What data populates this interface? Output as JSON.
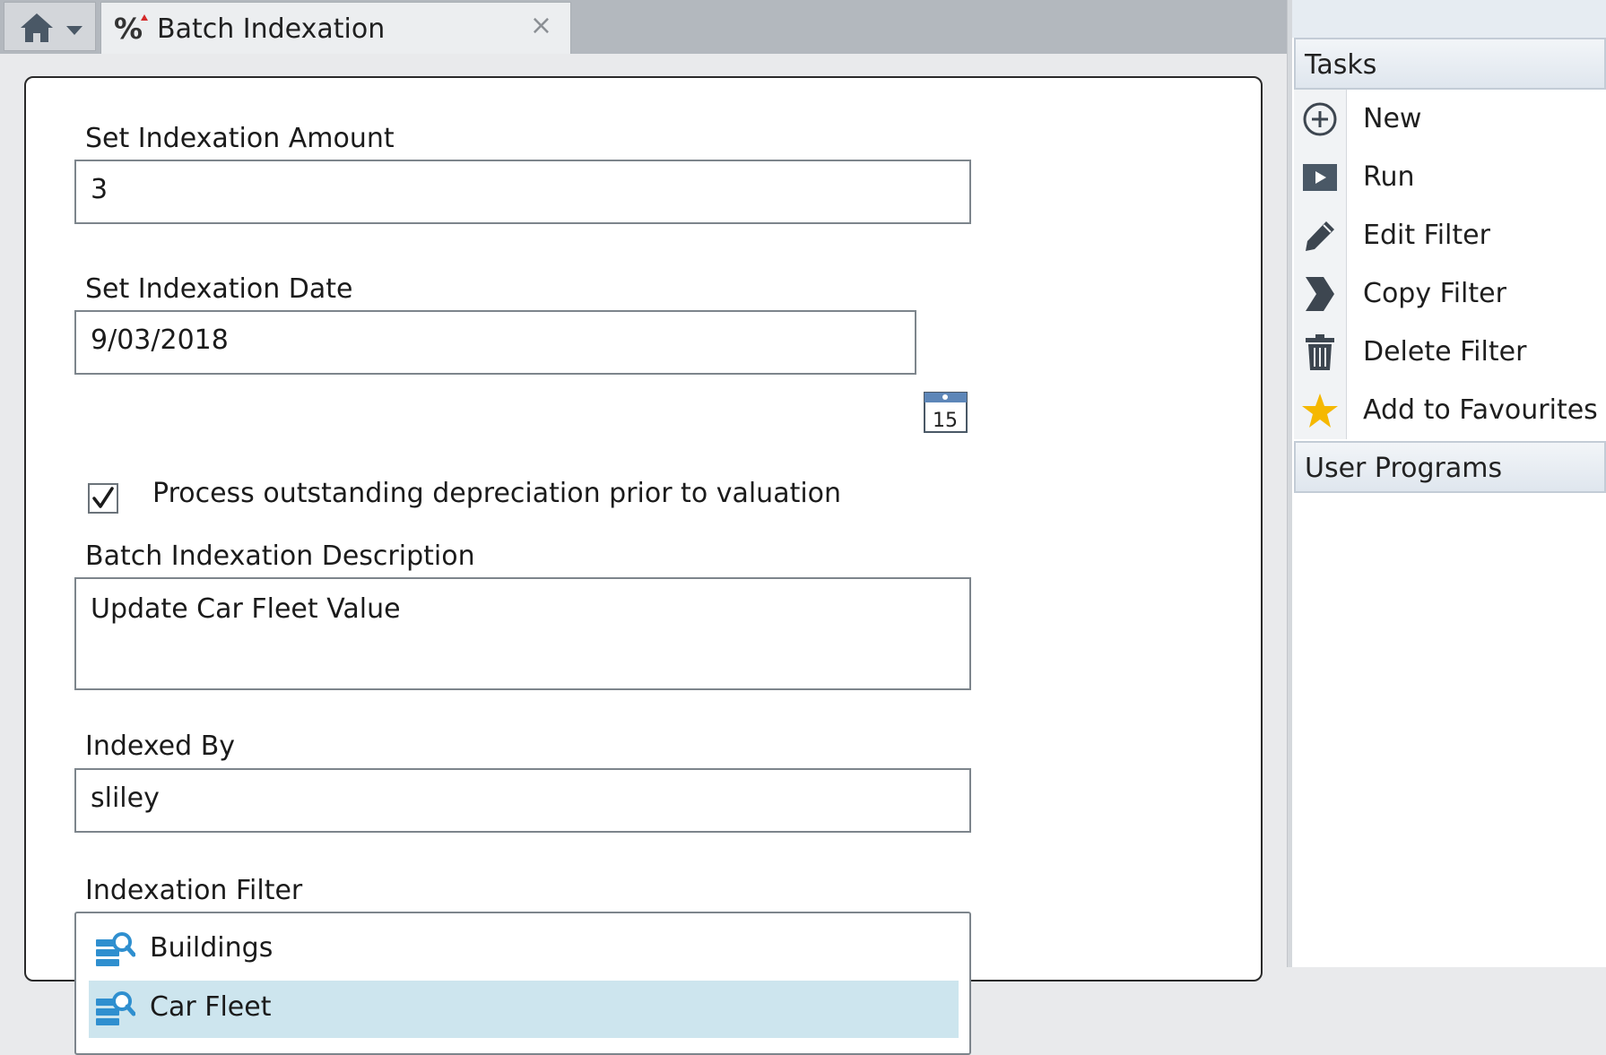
{
  "window": {
    "tab_title": "Batch Indexation",
    "close_glyph": "×"
  },
  "form": {
    "amount_label": "Set Indexation Amount",
    "amount_value": "3",
    "date_label": "Set Indexation Date",
    "date_value": "9/03/2018",
    "calendar_day": "15",
    "process_label": "Process outstanding depreciation prior to valuation",
    "process_checked": true,
    "description_label": "Batch Indexation Description",
    "description_value": "Update Car Fleet Value",
    "indexed_by_label": "Indexed By",
    "indexed_by_value": "sliley",
    "filter_label": "Indexation Filter",
    "filters": [
      {
        "label": "Buildings",
        "selected": false
      },
      {
        "label": "Car Fleet",
        "selected": true
      }
    ]
  },
  "panel": {
    "tasks_header": "Tasks",
    "tasks": [
      {
        "label": "New",
        "icon": "plus-circle-icon"
      },
      {
        "label": "Run",
        "icon": "play-icon"
      },
      {
        "label": "Edit Filter",
        "icon": "pencil-icon"
      },
      {
        "label": "Copy Filter",
        "icon": "copy-icon"
      },
      {
        "label": "Delete Filter",
        "icon": "trash-icon"
      },
      {
        "label": "Add to Favourites",
        "icon": "star-icon"
      }
    ],
    "user_programs_header": "User Programs"
  },
  "colors": {
    "selected_row": "#cde5ee",
    "star": "#f5b800",
    "filter_icon": "#2f8fcf"
  }
}
